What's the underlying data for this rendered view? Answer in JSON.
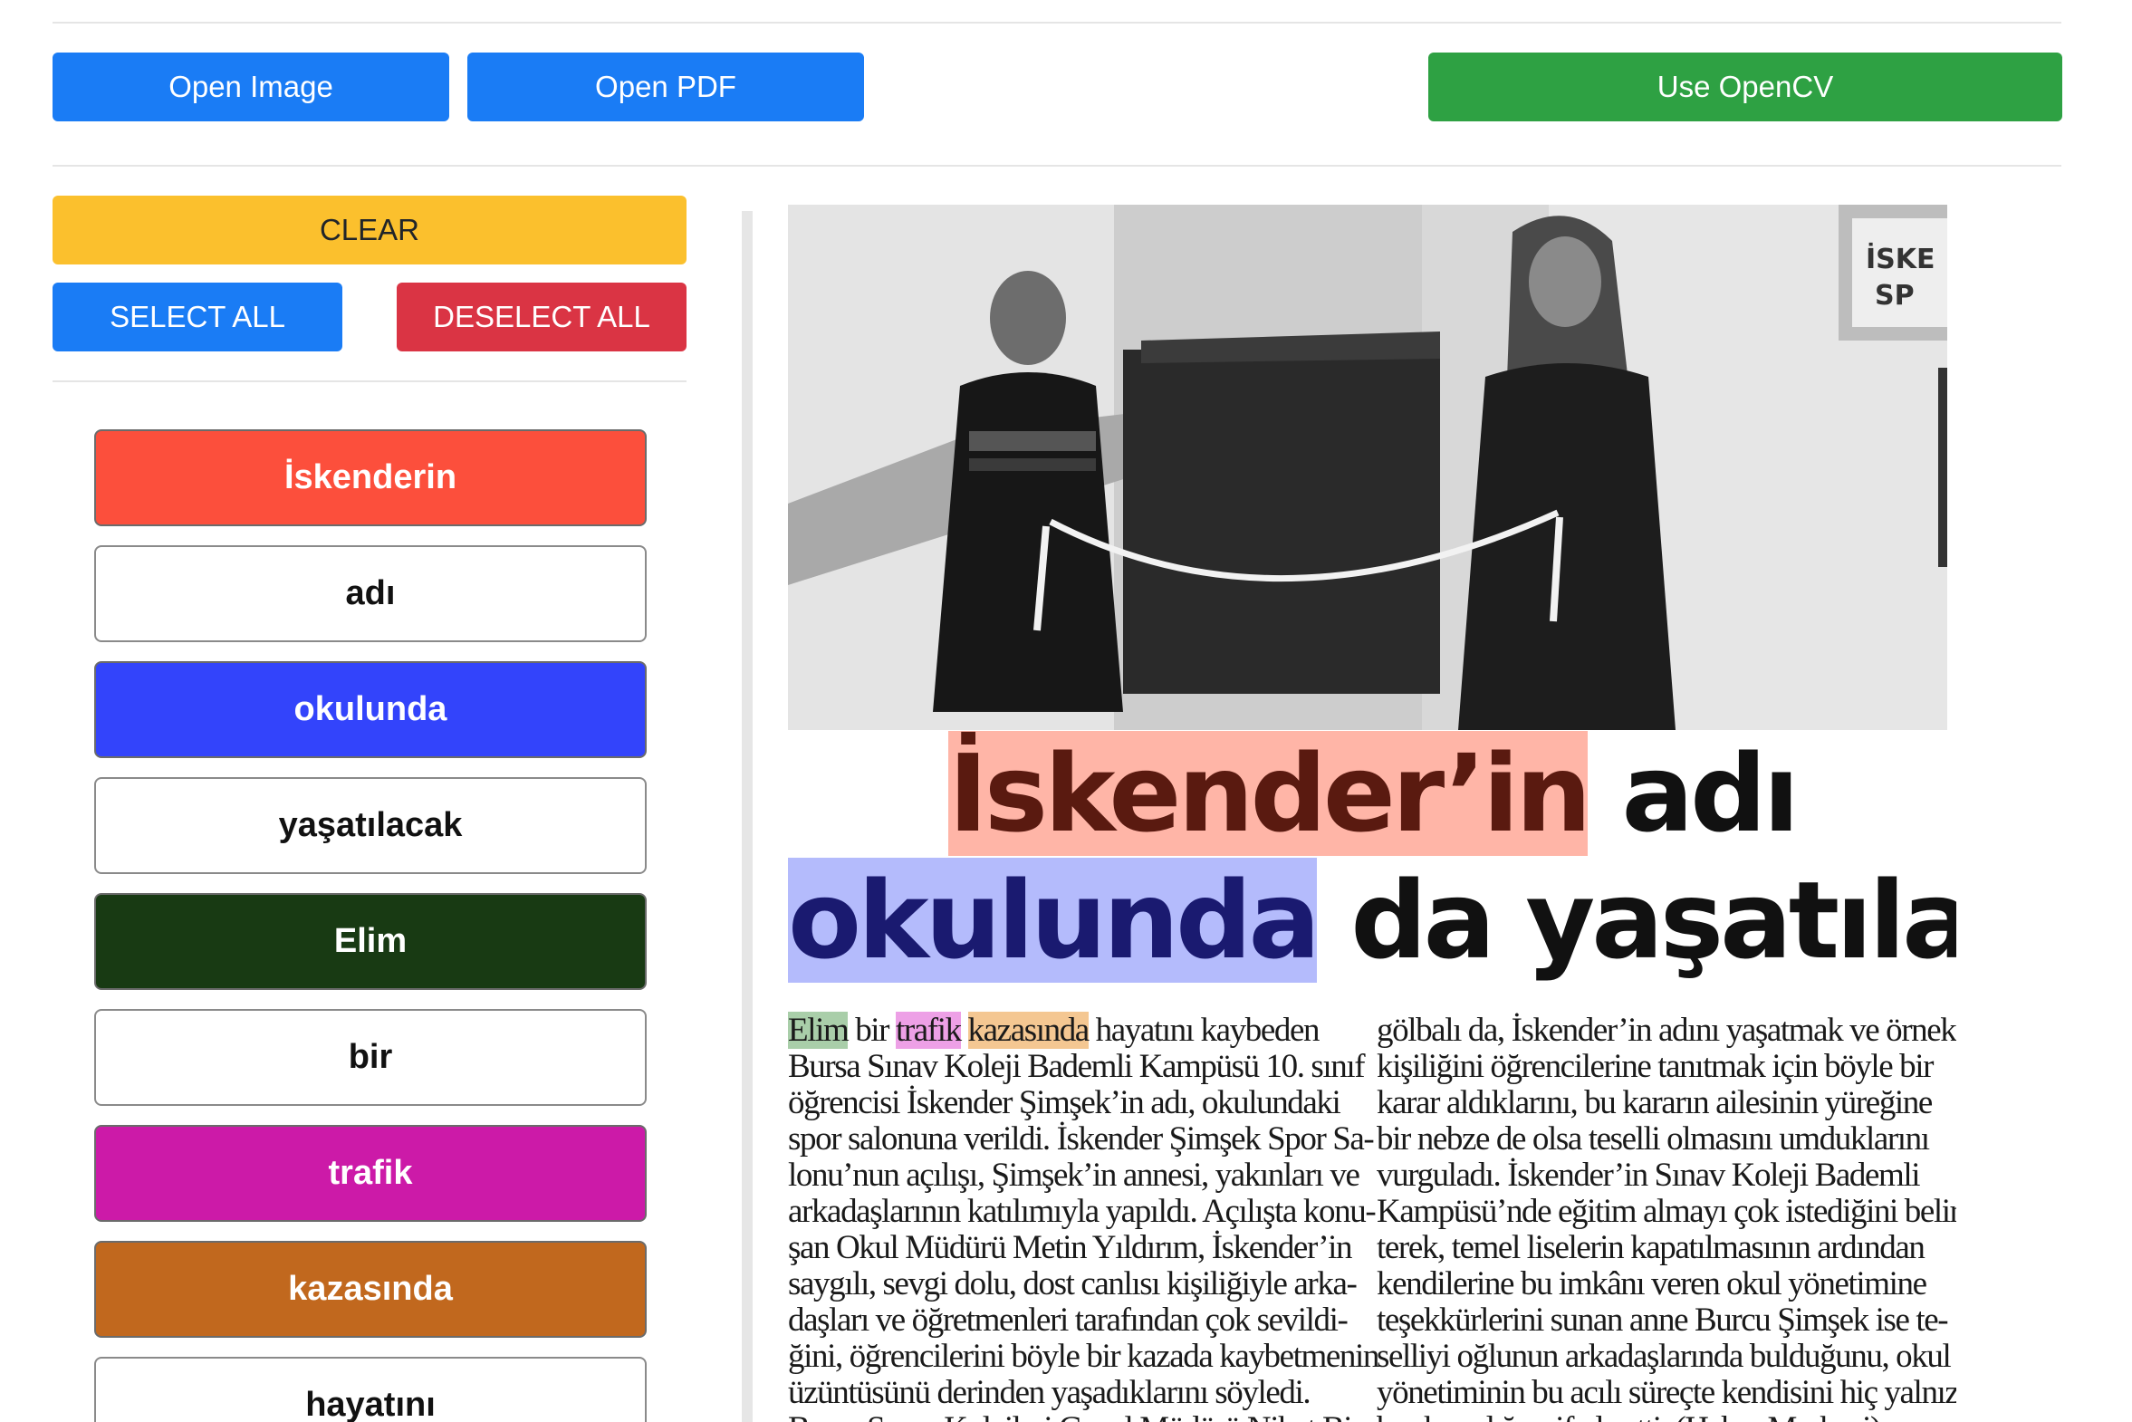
{
  "toolbar": {
    "open_image": "Open Image",
    "open_pdf": "Open PDF",
    "use_opencv": "Use OpenCV"
  },
  "controls": {
    "clear": "CLEAR",
    "select_all": "SELECT ALL",
    "deselect_all": "DESELECT ALL"
  },
  "colors": {
    "primary": "#1a7cf5",
    "success": "#2ea143",
    "warning": "#fbc02d",
    "danger": "#da3444"
  },
  "words": [
    {
      "text": "İskenderin",
      "selected": true,
      "color": "#fc4f3c"
    },
    {
      "text": "adı",
      "selected": false,
      "color": "#ffffff"
    },
    {
      "text": "okulunda",
      "selected": true,
      "color": "#3344fb"
    },
    {
      "text": "yaşatılacak",
      "selected": false,
      "color": "#ffffff"
    },
    {
      "text": "Elim",
      "selected": true,
      "color": "#183a13"
    },
    {
      "text": "bir",
      "selected": false,
      "color": "#ffffff"
    },
    {
      "text": "trafik",
      "selected": true,
      "color": "#cc1aa8"
    },
    {
      "text": "kazasında",
      "selected": true,
      "color": "#c1681e"
    },
    {
      "text": "hayatını",
      "selected": false,
      "color": "#ffffff"
    }
  ],
  "document": {
    "headline_line1": {
      "highlight": "İskender’in",
      "rest": " adı"
    },
    "headline_line2": {
      "highlight": "okulunda",
      "rest": " da yaşatılacak"
    },
    "photo_sign": "İSKE SP",
    "col1_first": {
      "w1": "Elim",
      "s1": " bir ",
      "w2": "trafik",
      "s2": " ",
      "w3": "kazasında",
      "rest": " hayatını kaybeden"
    },
    "col1_lines": [
      "Bursa Sınav Koleji Bademli Kampüsü 10. sınıf",
      "öğrencisi İskender Şimşek’in adı, okulundaki",
      "spor salonuna verildi. İskender Şimşek Spor Sa-",
      "lonu’nun açılışı, Şimşek’in annesi, yakınları ve",
      "arkadaşlarının katılımıyla yapıldı. Açılışta konu-",
      "şan Okul Müdürü Metin Yıldırım, İskender’in",
      "saygılı, sevgi dolu, dost canlısı kişiliğiyle arka-",
      "daşları ve öğretmenleri tarafından çok sevildi-",
      "ğini, öğrencilerini böyle bir kazada kaybetmenin",
      "üzüntüsünü derinden yaşadıklarını söyledi.",
      "Bursa Sınav Kolejleri Genel Müdürü Nihat Bir-"
    ],
    "col2_lines": [
      "gölbalı da, İskender’in adını yaşatmak ve örnek",
      "kişiliğini öğrencilerine tanıtmak için böyle bir",
      "karar aldıklarını, bu kararın ailesinin yüreğine",
      "bir nebze de olsa teselli olmasını umduklarını",
      "vurguladı. İskender’in Sınav Koleji Bademli",
      "Kampüsü’nde eğitim almayı çok istediğini belir-",
      "terek, temel liselerin kapatılmasının ardından",
      "kendilerine bu imkânı veren okul yönetimine",
      "teşekkürlerini sunan anne Burcu Şimşek ise te-",
      "selliyi oğlunun arkadaşlarında bulduğunu, okul",
      "yönetiminin bu acılı süreçte kendisini hiç yalnız",
      "bırakmadığını ifade etti. (Haber Merkezi)"
    ]
  }
}
